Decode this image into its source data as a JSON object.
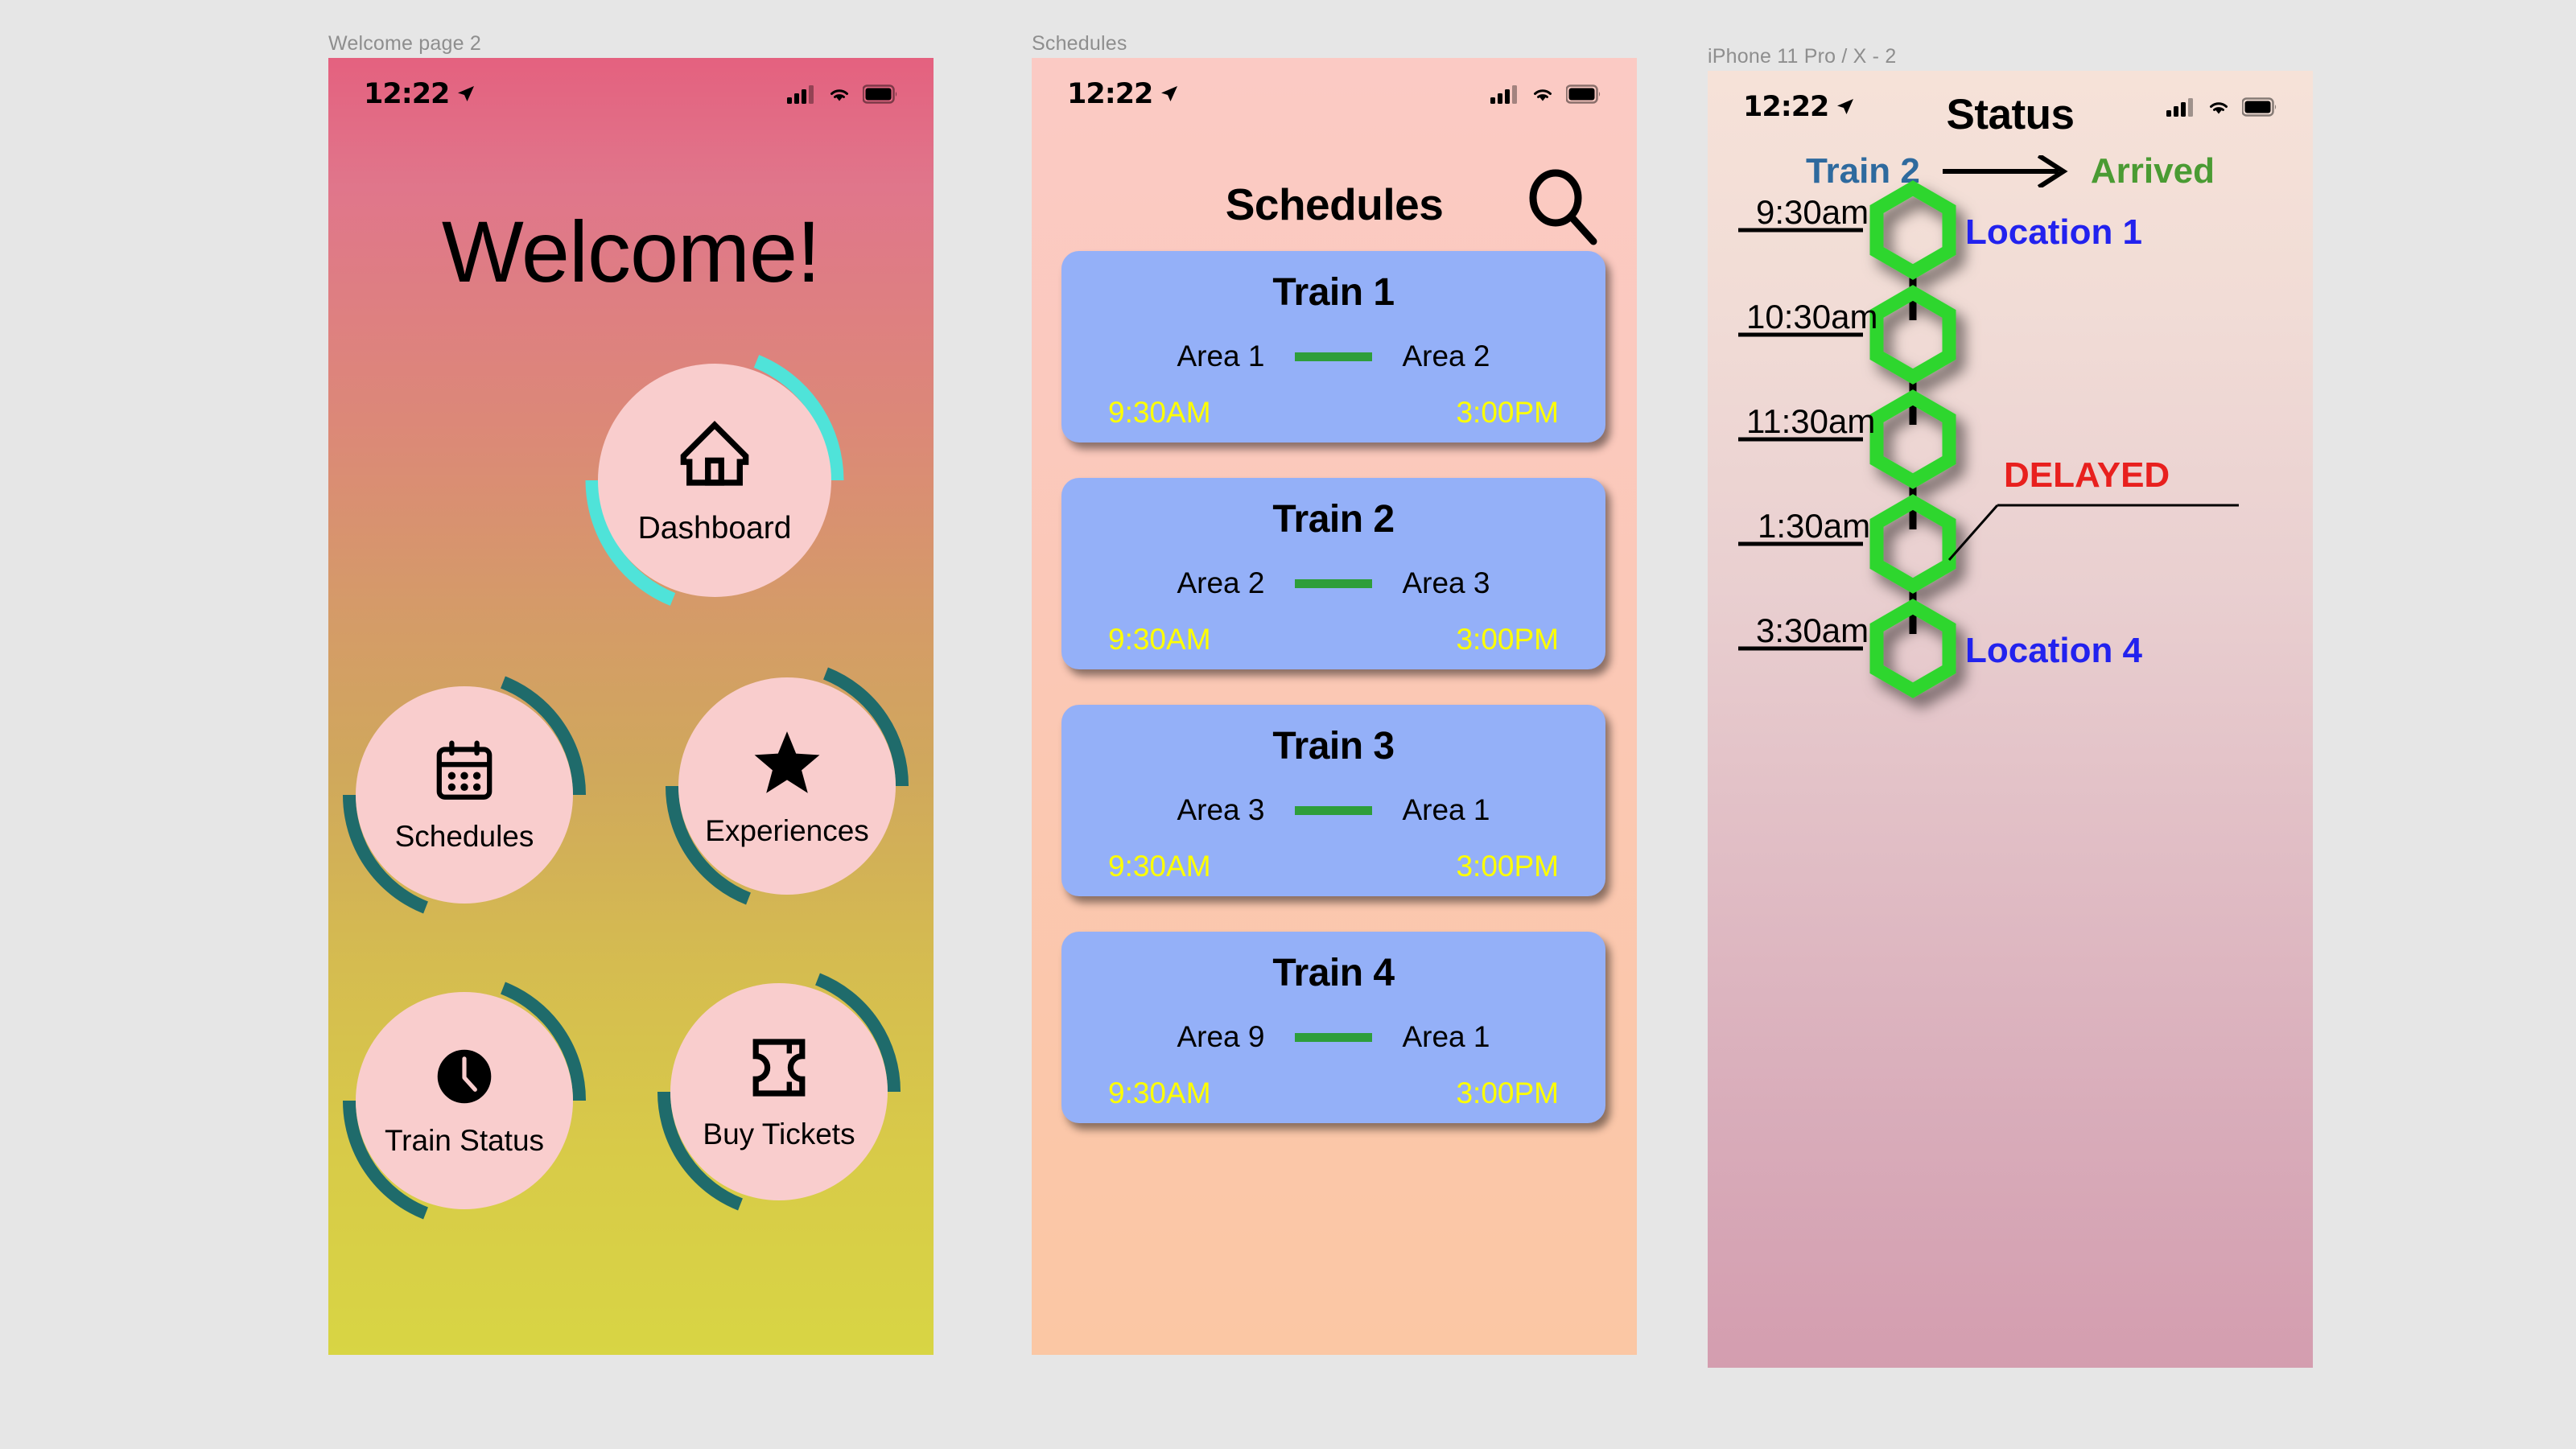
{
  "frames": [
    {
      "label": "Welcome page 2"
    },
    {
      "label": "Schedules"
    },
    {
      "label": "iPhone 11 Pro / X - 2"
    }
  ],
  "status_bar": {
    "time": "12:22",
    "location_icon": "location-arrow-icon",
    "cellular_icon": "cellular-signal-icon",
    "wifi_icon": "wifi-icon",
    "battery_icon": "battery-full-icon"
  },
  "welcome_screen": {
    "title": "Welcome!",
    "accent_arc_primary": "#4fe3d9",
    "accent_arc_secondary": "#1f6b6b",
    "disc_color": "#f9cdcd",
    "menu": [
      {
        "label": "Dashboard",
        "icon": "home-icon",
        "arc_color": "#4fe3d9"
      },
      {
        "label": "Schedules",
        "icon": "calendar-icon",
        "arc_color": "#1f6b6b"
      },
      {
        "label": "Experiences",
        "icon": "star-icon",
        "arc_color": "#1f6b6b"
      },
      {
        "label": "Train Status",
        "icon": "clock-icon",
        "arc_color": "#1f6b6b"
      },
      {
        "label": "Buy Tickets",
        "icon": "ticket-icon",
        "arc_color": "#1f6b6b"
      }
    ]
  },
  "schedules_screen": {
    "title": "Schedules",
    "search_icon": "search-icon",
    "card_color": "#94b0f8",
    "route_line_color": "#2e9e3a",
    "time_color": "#ffff00",
    "trains": [
      {
        "name": "Train 1",
        "from_area": "Area 1",
        "to_area": "Area 2",
        "depart": "9:30AM",
        "arrive": "3:00PM"
      },
      {
        "name": "Train 2",
        "from_area": "Area 2",
        "to_area": "Area 3",
        "depart": "9:30AM",
        "arrive": "3:00PM"
      },
      {
        "name": "Train 3",
        "from_area": "Area 3",
        "to_area": "Area 1",
        "depart": "9:30AM",
        "arrive": "3:00PM"
      },
      {
        "name": "Train 4",
        "from_area": "Area 9",
        "to_area": "Area 1",
        "depart": "9:30AM",
        "arrive": "3:00PM"
      }
    ]
  },
  "status_screen": {
    "title": "Status",
    "train_label": "Train 2",
    "train_label_color": "#2e6a9e",
    "arrow_icon": "arrow-right-icon",
    "status_label": "Arrived",
    "status_label_color": "#4a9b33",
    "node_color": "#2ed62e",
    "location_color": "#2222ee",
    "delayed_color": "#e8201e",
    "delayed_label": "DELAYED",
    "stops": [
      {
        "time": "9:30am",
        "location": "Location 1",
        "delayed": false
      },
      {
        "time": "10:30am",
        "location": "",
        "delayed": false
      },
      {
        "time": "11:30am",
        "location": "",
        "delayed": false
      },
      {
        "time": "1:30am",
        "location": "",
        "delayed": true
      },
      {
        "time": "3:30am",
        "location": "Location 4",
        "delayed": false
      }
    ]
  }
}
